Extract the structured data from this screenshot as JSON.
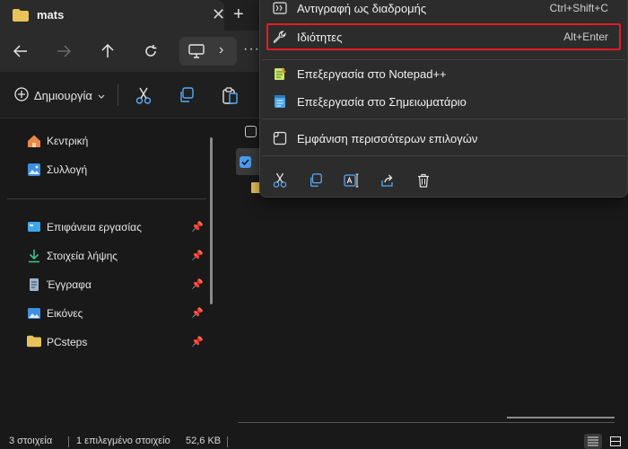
{
  "window": {
    "tab_title": "mats",
    "tab_close": "✕",
    "new_tab": "+"
  },
  "nav": {
    "more": "···",
    "chevron": "›"
  },
  "toolbar": {
    "new_label": "Δημιουργία"
  },
  "sidebar": {
    "items": [
      {
        "label": "Κεντρική",
        "icon": "home-icon",
        "pinned": false
      },
      {
        "label": "Συλλογή",
        "icon": "gallery-icon",
        "pinned": false
      },
      {
        "label": "Επιφάνεια εργασίας",
        "icon": "desktop-icon",
        "pinned": true
      },
      {
        "label": "Στοιχεία λήψης",
        "icon": "download-icon",
        "pinned": true
      },
      {
        "label": "Έγγραφα",
        "icon": "documents-icon",
        "pinned": true
      },
      {
        "label": "Εικόνες",
        "icon": "pictures-icon",
        "pinned": true
      },
      {
        "label": "PCsteps",
        "icon": "folder-icon",
        "pinned": true
      }
    ]
  },
  "context_menu": {
    "items": [
      {
        "label": "Αντιγραφή ως διαδρομής",
        "shortcut": "Ctrl+Shift+C",
        "icon": "copy-path-icon"
      },
      {
        "label": "Ιδιότητες",
        "shortcut": "Alt+Enter",
        "icon": "wrench-icon",
        "highlighted": true
      },
      {
        "label": "Επεξεργασία στο Notepad++",
        "shortcut": "",
        "icon": "notepadpp-icon"
      },
      {
        "label": "Επεξεργασία στο Σημειωματάριο",
        "shortcut": "",
        "icon": "notepad-icon"
      },
      {
        "label": "Εμφάνιση περισσότερων επιλογών",
        "shortcut": "",
        "icon": "more-options-icon"
      }
    ],
    "bottom_icons": [
      "cut-icon",
      "copy-icon",
      "rename-icon",
      "share-icon",
      "delete-icon"
    ]
  },
  "status": {
    "item_count": "3 στοιχεία",
    "selected": "1 επιλεγμένο στοιχείο",
    "size": "52,6 KB"
  },
  "colors": {
    "accent": "#4c9bf0",
    "highlight_border": "#e51b24",
    "folder": "#e8c35a"
  }
}
